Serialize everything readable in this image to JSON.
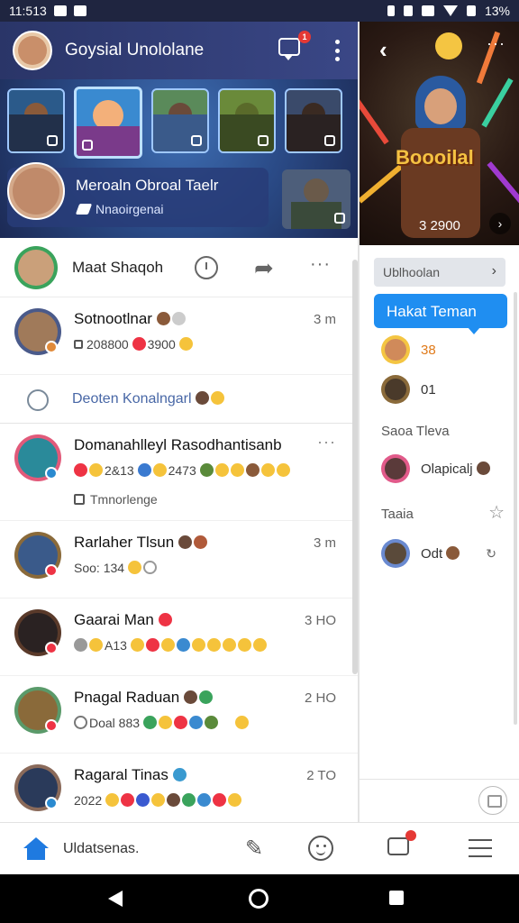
{
  "status_bar": {
    "time": "11:513",
    "battery": "13%"
  },
  "header": {
    "title": "Goysial Unololane",
    "notification_count": "1"
  },
  "stories": {
    "profile_name": "Meroaln Obroal Taelr",
    "profile_subtitle": "Nnaoirgenai"
  },
  "action_bar": {
    "name": "Maat Shaqoh"
  },
  "feed": [
    {
      "name": "Sotnootlnar",
      "sub": "208800",
      "sub2": "3900",
      "time": "3 m"
    },
    {
      "link_text": "Deoten Konalngarl"
    },
    {
      "name": "Domanahlleyl Rasodhantisanb",
      "sub": "2&13",
      "sub2": "2473",
      "extra": "Tmnorlenge"
    },
    {
      "name": "Rarlaher Tlsun",
      "sub": "Soo: 134",
      "time": "3 m"
    },
    {
      "name": "Gaarai Man",
      "sub": "A13",
      "time": "3 HO"
    },
    {
      "name": "Pnagal Raduan",
      "sub": "Doal 883",
      "time": "2 HO"
    },
    {
      "name": "Ragaral Tinas",
      "sub": "2022",
      "time": "2 TO"
    }
  ],
  "right_panel": {
    "banner_title": "Boooilal",
    "banner_count": "3 2900",
    "pill_text": "Ublhoolan",
    "bubble_text": "Hakat Teman",
    "row1": "38",
    "row2": "01",
    "section1": "Saoa Tleva",
    "row3": "Olapicalj",
    "section2": "Taaia",
    "row4": "Odt"
  },
  "tab_bar": {
    "label": "Uldatsenas."
  },
  "colors": {
    "header": "#2a3568",
    "accent": "#1f8ef1",
    "link": "#4867a6"
  },
  "icons": [
    "home-icon",
    "pencil-icon",
    "smile-icon",
    "message-icon",
    "menu-icon",
    "share-icon",
    "more-icon",
    "back-icon",
    "chevron-right-icon"
  ]
}
